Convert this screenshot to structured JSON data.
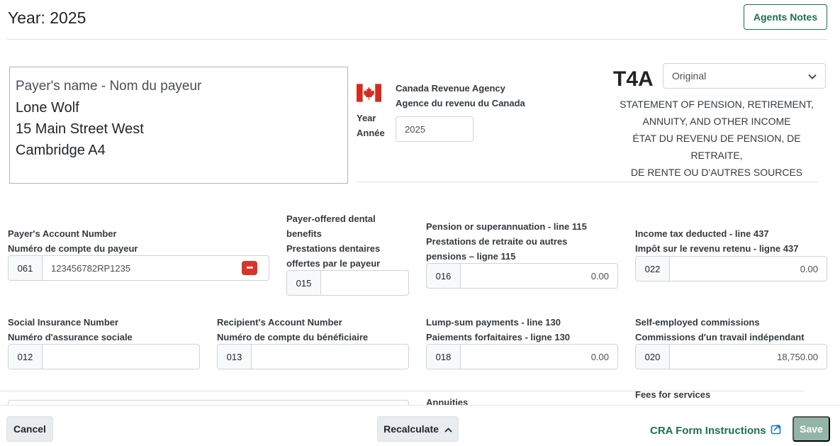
{
  "header": {
    "year_title": "Year: 2025",
    "agents_notes_label": "Agents Notes"
  },
  "payer": {
    "label": "Payer's name - Nom du payeur",
    "name": "Lone Wolf",
    "address1": "15 Main Street West",
    "address2": "Cambridge A4"
  },
  "agency": {
    "name_en": "Canada Revenue Agency",
    "name_fr": "Agence du revenu du Canada",
    "year_label_en": "Year",
    "year_label_fr": "Année",
    "year_value": "2025",
    "flag_icon": "canada-flag-icon"
  },
  "form": {
    "title": "T4A",
    "type_selected": "Original",
    "statement_line1": "STATEMENT OF PENSION, RETIREMENT,",
    "statement_line2": "ANNUITY, AND OTHER INCOME",
    "statement_line3": "ÉTAT DU REVENU DE PENSION, DE RETRAITE,",
    "statement_line4": "DE RENTE OU D'AUTRES SOURCES"
  },
  "fields": {
    "payer_account": {
      "label_en": "Payer's Account Number",
      "label_fr": "Numéro de compte du payeur",
      "code": "061",
      "value": "123456782RP1235"
    },
    "dental": {
      "label1": "Payer-offered dental",
      "label2": "benefits",
      "label3": "Prestations dentaires",
      "label4": "offertes par le payeur",
      "code": "015",
      "value": ""
    },
    "pension": {
      "label1": "Pension or superannuation - line 115",
      "label2": "Prestations de retraite ou autres",
      "label3": "pensions – ligne 115",
      "code": "016",
      "value": "0.00"
    },
    "income_tax": {
      "label_en": "Income tax deducted - line 437",
      "label_fr": "Impôt sur le revenu retenu - ligne 437",
      "code": "022",
      "value": "0.00"
    },
    "sin": {
      "label_en": "Social Insurance Number",
      "label_fr": "Numéro d'assurance sociale",
      "code": "012",
      "value": ""
    },
    "recipient_account": {
      "label_en": "Recipient's Account Number",
      "label_fr": "Numéro de compte du bénéficiaire",
      "code": "013",
      "value": ""
    },
    "lump_sum": {
      "label_en": "Lump-sum payments - line 130",
      "label_fr": "Paiements forfaitaires - ligne 130",
      "code": "018",
      "value": "0.00"
    },
    "self_employed": {
      "label_en": "Self-employed commissions",
      "label_fr": "Commissions d'un travail indépendant",
      "code": "020",
      "value": "18,750.00"
    },
    "annuities": {
      "label_en": "Annuities"
    },
    "fees": {
      "label_en": "Fees for services"
    }
  },
  "footer": {
    "cancel_label": "Cancel",
    "recalculate_label": "Recalculate",
    "cra_instructions_label": "CRA Form Instructions",
    "save_label": "Save"
  },
  "colors": {
    "accent": "#1e6e54",
    "save_disabled": "#93b5a7",
    "flag_red": "#d52b1e",
    "password_button": "#d9342b"
  }
}
